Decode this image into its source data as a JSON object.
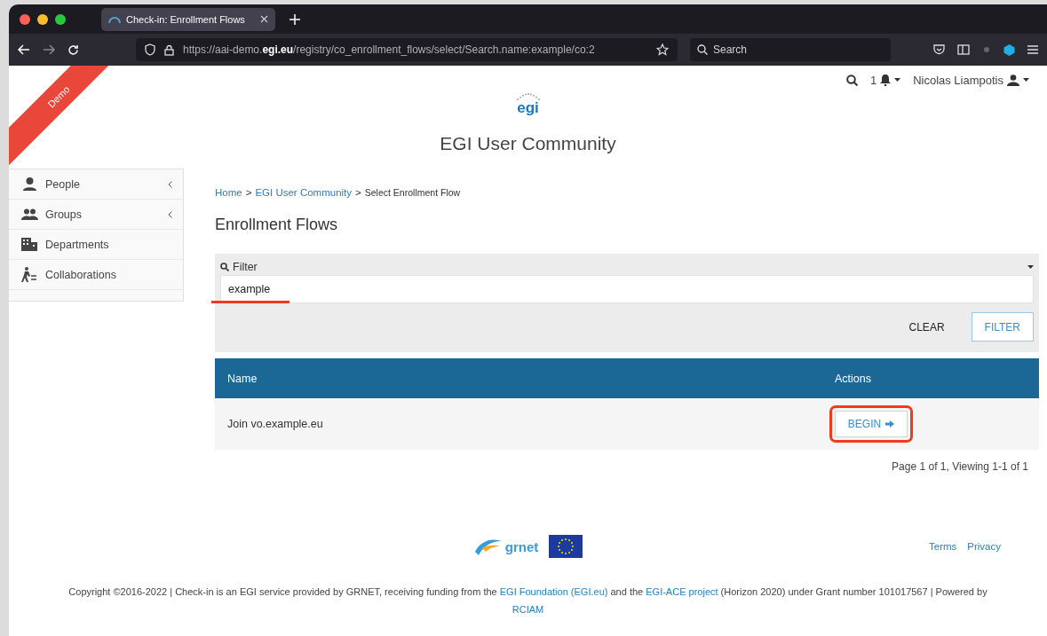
{
  "browser": {
    "tab_title": "Check-in: Enrollment Flows",
    "url_host_before": "https://aai-demo.",
    "url_host_bold": "egi.eu",
    "url_path": "/registry/co_enrollment_flows/select/Search.name:example/co:2",
    "search_placeholder": "Search"
  },
  "ribbon": "Demo",
  "user_bar": {
    "notification_count": "1",
    "user_name": "Nicolas Liampotis"
  },
  "logo_text": "egi",
  "site_title": "EGI User Community",
  "sidebar": {
    "items": [
      {
        "label": "People",
        "kind": "person",
        "has_submenu": true
      },
      {
        "label": "Groups",
        "kind": "group",
        "has_submenu": true
      },
      {
        "label": "Departments",
        "kind": "building",
        "has_submenu": false
      },
      {
        "label": "Collaborations",
        "kind": "walker",
        "has_submenu": false
      }
    ]
  },
  "breadcrumb": {
    "links": [
      "Home",
      "EGI User Community"
    ],
    "current": "Select Enrollment Flow",
    "separator": ">"
  },
  "heading": "Enrollment Flows",
  "filter": {
    "label": "Filter",
    "value": "example",
    "buttons": [
      {
        "label": "CLEAR",
        "kind": "plain"
      },
      {
        "label": "FILTER",
        "kind": "outline"
      }
    ]
  },
  "table": {
    "columns": [
      "Name",
      "Actions"
    ],
    "rows": [
      {
        "name": "Join vo.example.eu",
        "action": "BEGIN"
      }
    ]
  },
  "pagination": "Page 1 of 1, Viewing 1-1 of 1",
  "footer": {
    "grnet_logo": "grnet",
    "links": [
      "Terms",
      "Privacy"
    ],
    "copyright": [
      {
        "text": "Copyright ©2016-2022 | Check-in is an EGI service provided by GRNET, receiving funding from the ",
        "link": false
      },
      {
        "text": "EGI Foundation (EGI.eu)",
        "link": true
      },
      {
        "text": " and the ",
        "link": false
      },
      {
        "text": "EGI-ACE project",
        "link": true
      },
      {
        "text": " (Horizon 2020) under Grant number 101017567 | Powered by ",
        "link": false
      },
      {
        "text": "RCIAM",
        "link": true
      }
    ]
  }
}
